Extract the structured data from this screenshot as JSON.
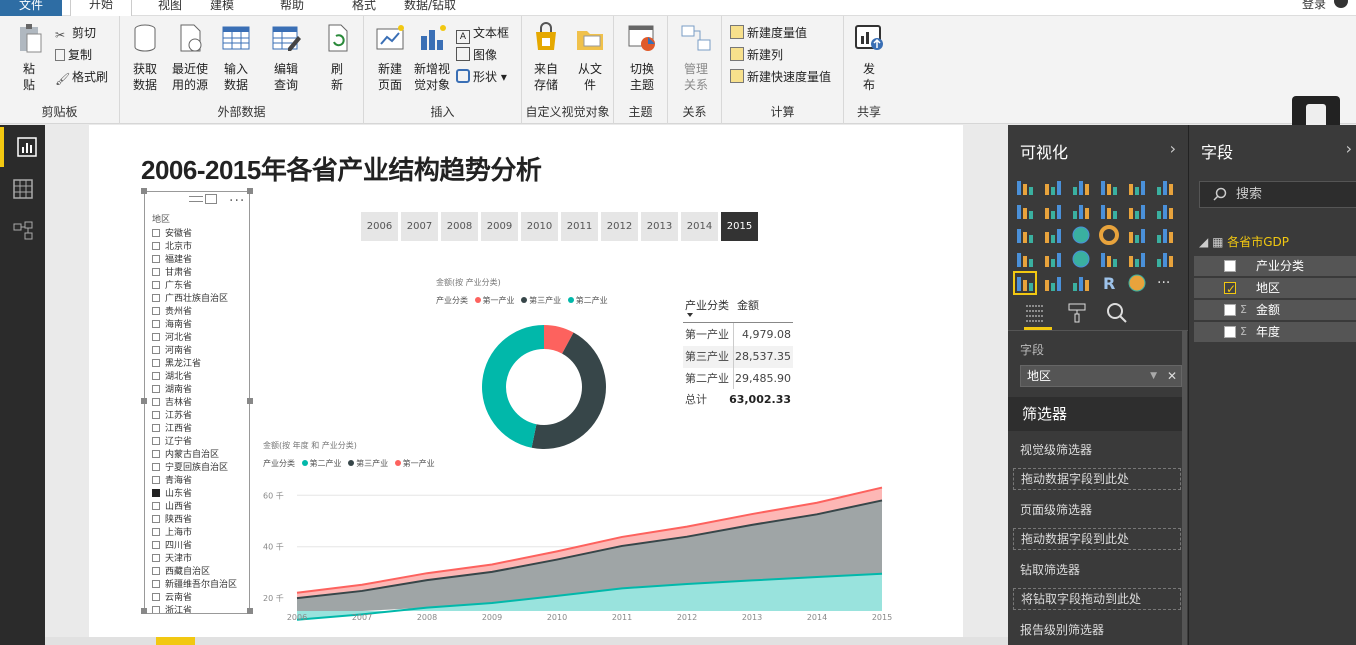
{
  "menu": {
    "file": "文件",
    "tabs": [
      "开始",
      "视图",
      "建模",
      "帮助",
      "格式",
      "数据/钻取"
    ],
    "login": "登录"
  },
  "ribbon": {
    "clipboard": {
      "paste": [
        "粘",
        "贴"
      ],
      "cut": "剪切",
      "copy": "复制",
      "format_painter": "格式刷",
      "label": "剪贴板"
    },
    "external": {
      "get_data": [
        "获取",
        "数据"
      ],
      "recent": [
        "最近使",
        "用的源"
      ],
      "enter": [
        "输入",
        "数据"
      ],
      "edit": [
        "编辑",
        "查询"
      ],
      "refresh": [
        "刷",
        "新"
      ],
      "label": "外部数据"
    },
    "insert": {
      "new_page": [
        "新建",
        "页面"
      ],
      "new_visual": [
        "新增视",
        "觉对象"
      ],
      "textbox": "文本框",
      "image": "图像",
      "shapes": "形状",
      "label": "插入"
    },
    "custom": {
      "from_store": [
        "来自",
        "存储"
      ],
      "from_file": [
        "从文",
        "件"
      ],
      "label": "自定义视觉对象"
    },
    "theme": {
      "switch": [
        "切换",
        "主题"
      ],
      "label": "主题"
    },
    "relations": {
      "manage": [
        "管理",
        "关系"
      ],
      "label": "关系"
    },
    "calc": {
      "new_measure": "新建度量值",
      "new_column": "新建列",
      "new_quick": "新建快速度量值",
      "label": "计算"
    },
    "share": {
      "publish": [
        "发",
        "布"
      ],
      "label": "共享"
    }
  },
  "report": {
    "title": "2006-2015年各省产业结构趋势分析",
    "slicer_title": "地区",
    "regions": [
      "安徽省",
      "北京市",
      "福建省",
      "甘肃省",
      "广东省",
      "广西壮族自治区",
      "贵州省",
      "海南省",
      "河北省",
      "河南省",
      "黑龙江省",
      "湖北省",
      "湖南省",
      "吉林省",
      "江苏省",
      "江西省",
      "辽宁省",
      "内蒙古自治区",
      "宁夏回族自治区",
      "青海省",
      "山东省",
      "山西省",
      "陕西省",
      "上海市",
      "四川省",
      "天津市",
      "西藏自治区",
      "新疆维吾尔自治区",
      "云南省",
      "浙江省"
    ],
    "selected_region": "山东省",
    "years": [
      "2006",
      "2007",
      "2008",
      "2009",
      "2010",
      "2011",
      "2012",
      "2013",
      "2014",
      "2015"
    ],
    "selected_year": "2015",
    "donut_title": "金额(按 产业分类)",
    "donut_legend_label": "产业分类",
    "table": {
      "headers": [
        "产业分类",
        "金额"
      ],
      "rows": [
        {
          "name": "第一产业",
          "value": "4,979.08"
        },
        {
          "name": "第三产业",
          "value": "28,537.35"
        },
        {
          "name": "第二产业",
          "value": "29,485.90"
        }
      ],
      "total_label": "总计",
      "total_value": "63,002.33"
    },
    "area_title": "金额(按 年度 和 产业分类)",
    "area_legend_label": "产业分类"
  },
  "colors": {
    "first": "#fd625e",
    "second": "#01b8aa",
    "third": "#374649",
    "accent": "#f2c811"
  },
  "chart_data": [
    {
      "type": "pie",
      "title": "金额(按 产业分类)",
      "legend_title": "产业分类",
      "categories": [
        "第一产业",
        "第三产业",
        "第二产业"
      ],
      "values": [
        4979.08,
        28537.35,
        29485.9
      ]
    },
    {
      "type": "area",
      "title": "金额(按 年度 和 产业分类)",
      "legend_title": "产业分类",
      "x": [
        2006,
        2007,
        2008,
        2009,
        2010,
        2011,
        2012,
        2013,
        2014,
        2015
      ],
      "series": [
        {
          "name": "第二产业",
          "values": [
            11.6,
            13.7,
            16.3,
            18.1,
            20.9,
            23.8,
            25.5,
            26.9,
            28.2,
            29.5
          ]
        },
        {
          "name": "第三产业",
          "values": [
            8.4,
            9.1,
            10.7,
            12.1,
            14.1,
            16.5,
            18.4,
            21.6,
            24.4,
            28.5
          ]
        },
        {
          "name": "第一产业",
          "values": [
            2.1,
            2.4,
            2.7,
            2.9,
            3.2,
            3.5,
            3.9,
            4.2,
            4.5,
            5.0
          ]
        }
      ],
      "y_ticks": [
        "20 千",
        "40 千",
        "60 千"
      ],
      "ylim": [
        15,
        64
      ]
    }
  ],
  "viz": {
    "title": "可视化",
    "field_label": "字段",
    "field_value": "地区",
    "filters": "筛选器",
    "visual_level": "视觉级筛选器",
    "drag_here": "拖动数据字段到此处",
    "page_level": "页面级筛选器",
    "drill": "钻取筛选器",
    "drill_drag": "将钻取字段拖动到此处",
    "report_level": "报告级别筛选器"
  },
  "fields": {
    "title": "字段",
    "search_placeholder": "搜索",
    "table": "各省市GDP",
    "items": [
      "产业分类",
      "地区",
      "金额",
      "年度"
    ]
  }
}
